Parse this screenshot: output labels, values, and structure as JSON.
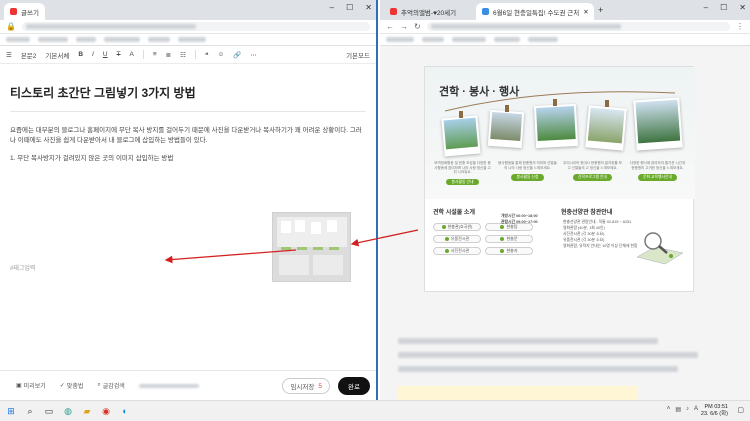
{
  "left_window": {
    "tab_title": "글쓰기",
    "toolbar": {
      "body_style": "본문",
      "body_dropdown": "본문2",
      "font": "기본서체",
      "bold": "B",
      "italic": "I",
      "underline": "U",
      "strike": "T",
      "basic_mode": "기본모드"
    },
    "post": {
      "title": "티스토리 초간단 그림넣기 3가지 방법",
      "paragraph1": "요즘에는 대부분의 블로그나 홈페이지에 무단 복사 방지를 걸어두기 때문에 사진을 다운받거나 복사하기가 꽤 어려운 상황이다. 그러나 이때에도 사진을 쉽게 다운받아서 내 블로그에 삽입하는 방법들이 있다.",
      "paragraph2": "1. 무단 복사방지가 걸려있지 않은 곳의 이미지 삽입하는 방법",
      "tag_placeholder": "#태그입력"
    },
    "bottom": {
      "preview": "미리보기",
      "spellcheck": "맞춤법",
      "shortcuts": "글감검색",
      "temp_save": "임시저장",
      "temp_count": "5",
      "done": "완료"
    }
  },
  "right_window": {
    "tabs": [
      {
        "label": "추억의앨범-♥20세기"
      },
      {
        "label": "6월6일 현충일특집! 수도권 근처"
      }
    ],
    "card": {
      "title": "견학 · 봉사 · 행사",
      "columns": [
        {
          "text": "묘역정화활동 및 헌충 조성을 다양한 봉사활동에 참여하며 나라 사랑 정신을 고취 시켜줘요.",
          "button": "봉사활동 안내"
        },
        {
          "text": "봉사활동을 통해 현충원의 의미와 선열들의 나라 사랑 정신을 느껴보세요.",
          "button": "봉사활동 신청"
        },
        {
          "text": "우리나라의 현대사 현충원의 발자취를 보고 선열들의 고 정신을 느껴보세요.",
          "button": "견학프로그램 안내"
        },
        {
          "text": "다양한 행사에 참여하여 즐거운 시간과 현충원의 고귀한 정신을 느껴보세요.",
          "button": "문화 교육행사안내"
        }
      ],
      "facilities_title": "견학 시설물 소개",
      "halls": [
        "현충관(호국관)",
        "유품전시관",
        "사진전시관",
        "현충탑",
        "현충문",
        "현충지"
      ],
      "hours": [
        "개방시간 06:00~18:00",
        "관람시간 09:00~17:00"
      ],
      "guide_title": "현충선양관 참관안내",
      "guide_lines": [
        "현충선양관 관람안내 : 직통 02-815 ~ 6251",
        "영화관람 (40분, 1회 40인)",
        "사진전시관 (각 30분 소요)",
        "유품전시관 (각 30분 소요)",
        "영화관람, 유적지 안내는 10명 이상 단체에 한함"
      ]
    }
  },
  "taskbar": {
    "time": "PM 03:51",
    "date": "23. 6/6 (화)"
  },
  "colors": {
    "accent_green": "#6aaa2b",
    "arrow_red": "#d42020",
    "window_border": "#2e6fb8"
  }
}
